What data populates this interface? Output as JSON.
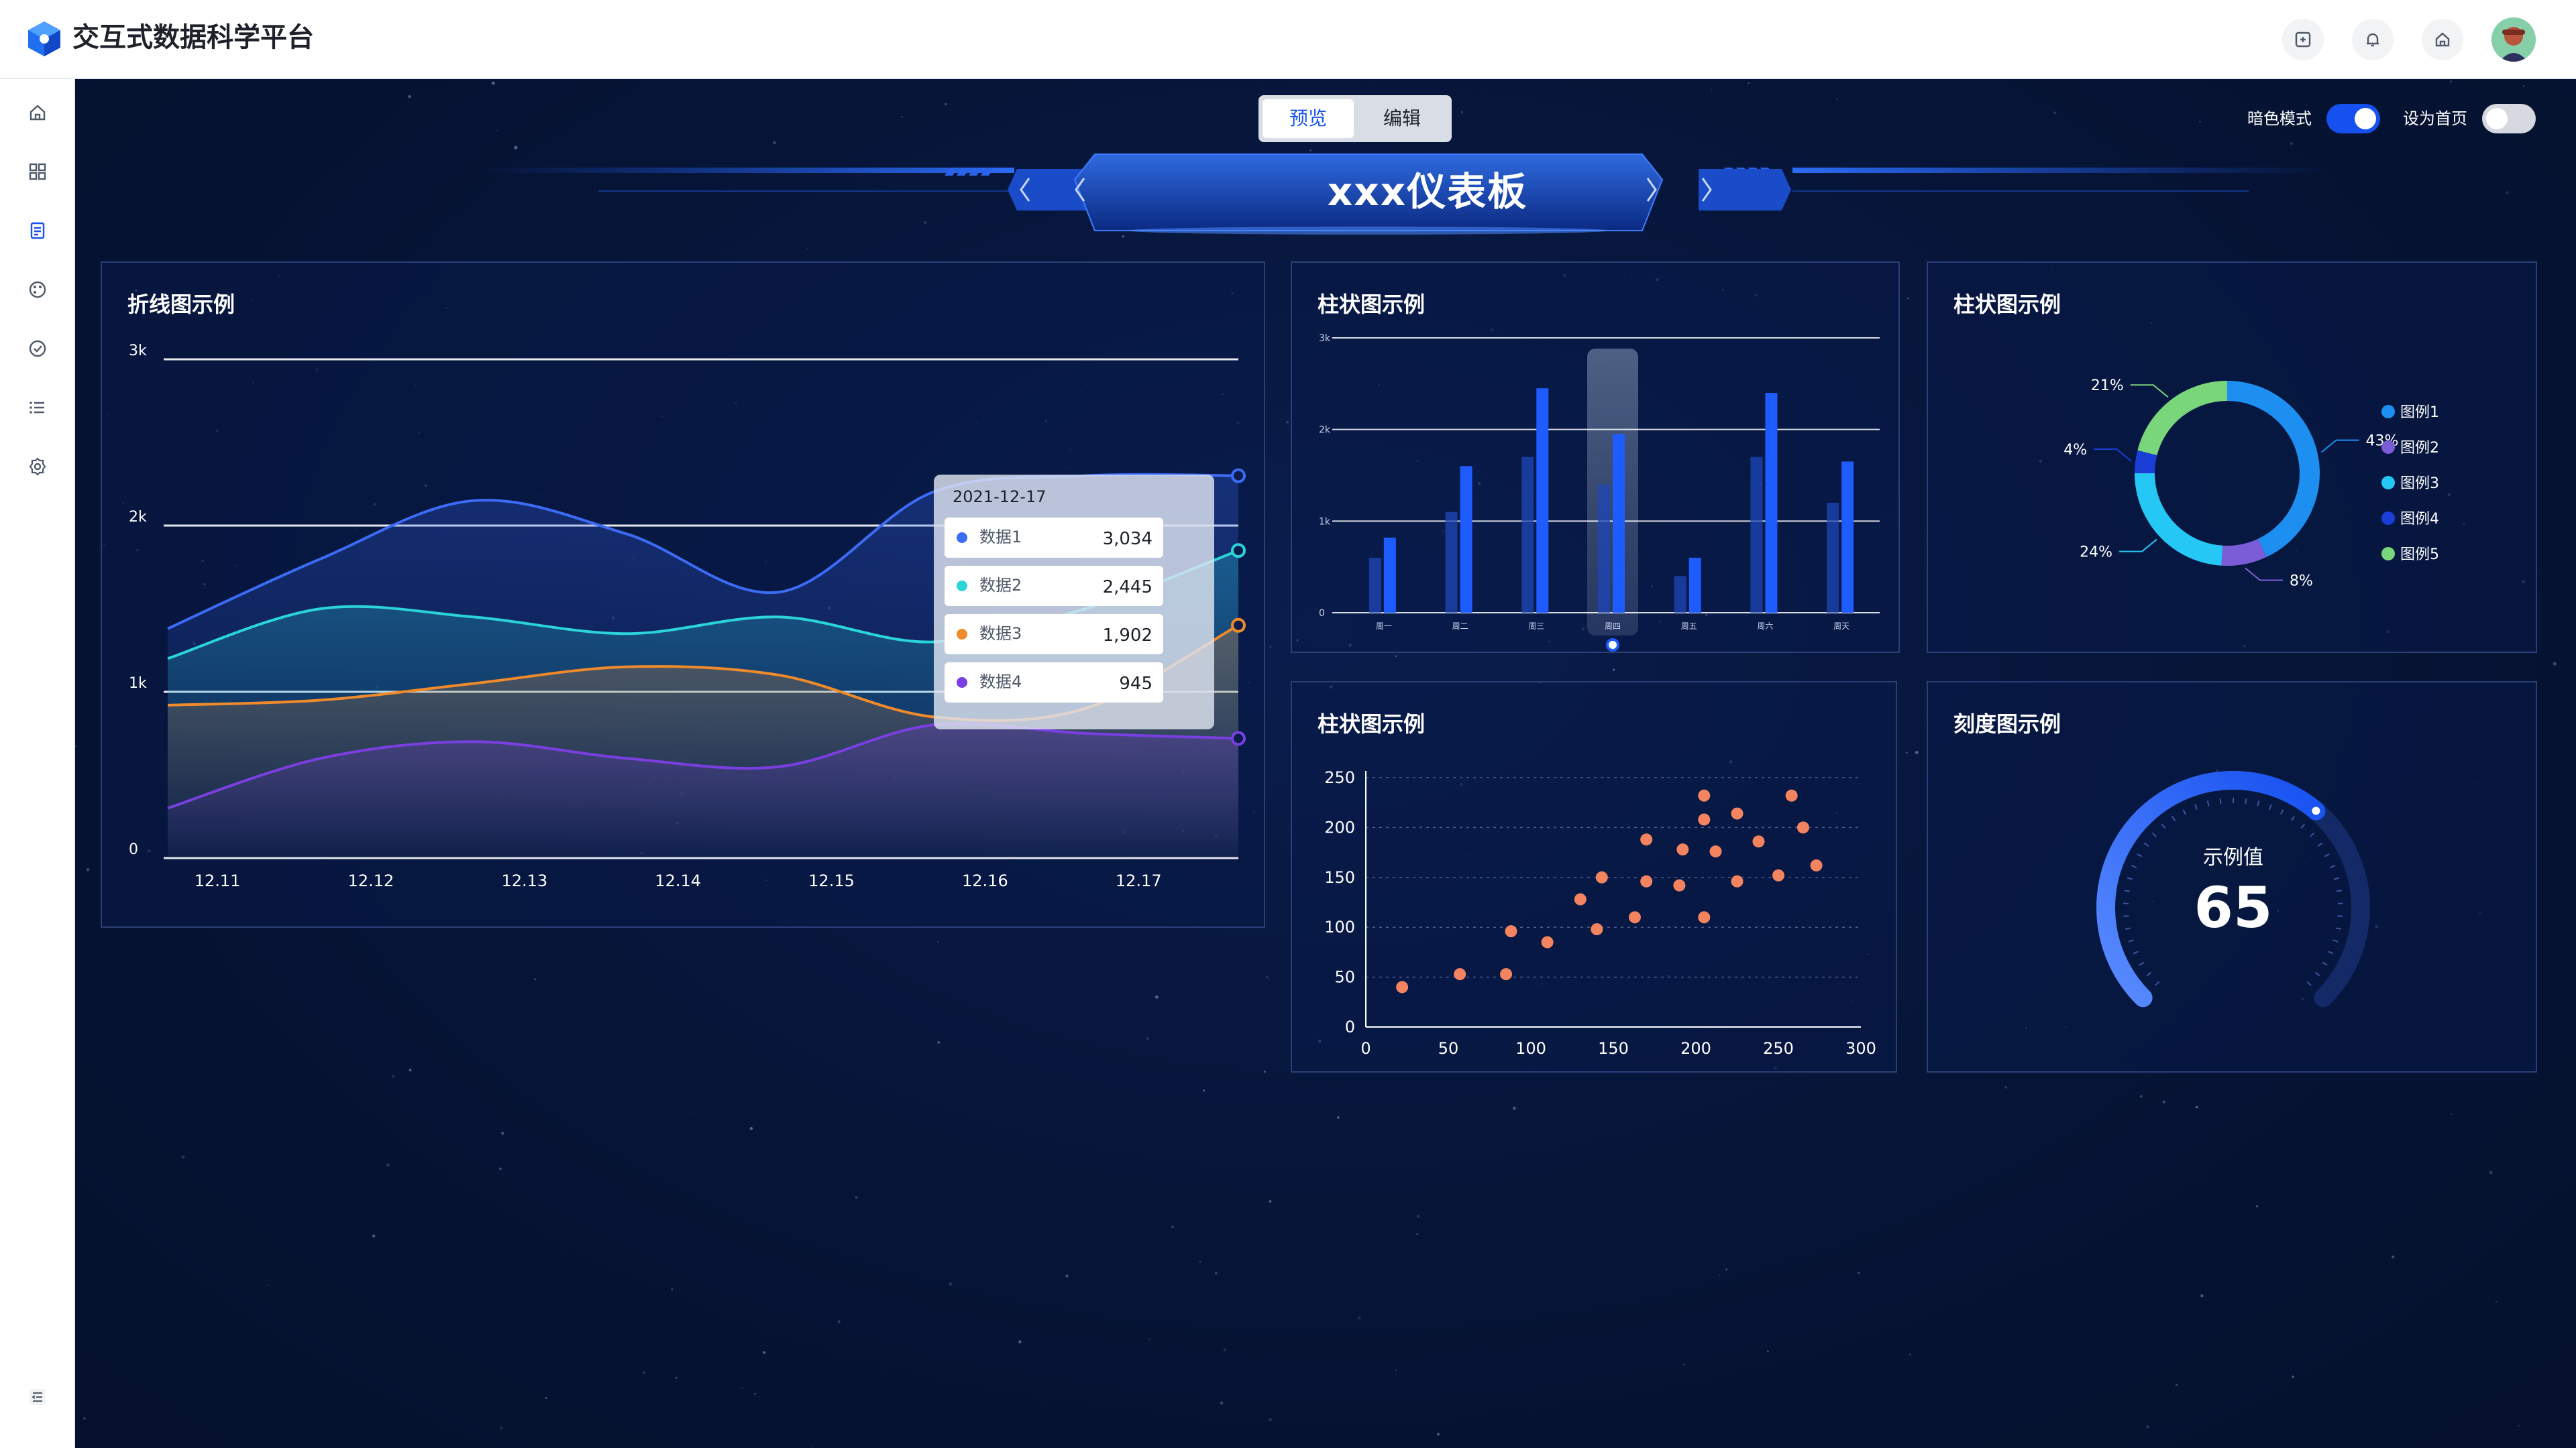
{
  "app": {
    "title": "交互式数据科学平台"
  },
  "header": {
    "icons": [
      "fullscreen-icon",
      "bell-icon",
      "home-icon"
    ],
    "avatar": "user-avatar"
  },
  "sidebar": {
    "items": [
      "home-icon",
      "grid-icon",
      "document-icon",
      "palette-icon",
      "check-circle-icon",
      "list-icon",
      "settings-icon"
    ],
    "collapse": "collapse-icon"
  },
  "mode_tabs": {
    "preview": "预览",
    "edit": "编辑",
    "active": "预览"
  },
  "toggles": {
    "dark_mode": {
      "label": "暗色模式",
      "on": true
    },
    "set_homepage": {
      "label": "设为首页",
      "on": false
    }
  },
  "dashboard": {
    "title": "xxx仪表板"
  },
  "colors": {
    "accent": "#1650f0",
    "bg": "#061233",
    "panel_border": "#2a3f76",
    "series1": "#3c6bf5",
    "series2": "#2ad4d8",
    "series3": "#f08a2a",
    "series4": "#7a3fe0",
    "scatter": "#f4845f"
  },
  "line_chart": {
    "title": "折线图示例",
    "tooltip": {
      "date": "2021-12-17",
      "rows": [
        {
          "name": "数据1",
          "value": "3,034"
        },
        {
          "name": "数据2",
          "value": "2,445"
        },
        {
          "name": "数据3",
          "value": "1,902"
        },
        {
          "name": "数据4",
          "value": "945"
        }
      ]
    }
  },
  "bar_chart": {
    "title": "柱状图示例"
  },
  "donut_chart": {
    "title": "柱状图示例"
  },
  "scatter_chart": {
    "title": "柱状图示例"
  },
  "gauge_chart": {
    "title": "刻度图示例",
    "label": "示例值",
    "value": 65
  },
  "chart_data": [
    {
      "type": "line",
      "title": "折线图示例",
      "x": [
        "12.11",
        "12.12",
        "12.13",
        "12.14",
        "12.15",
        "12.16",
        "12.17"
      ],
      "yticks": [
        "0",
        "1k",
        "2k",
        "3k"
      ],
      "ylim": [
        0,
        3000
      ],
      "grid": true,
      "series": [
        {
          "name": "数据1",
          "values": [
            1380,
            1800,
            2150,
            1950,
            1600,
            2200,
            2300,
            2300
          ]
        },
        {
          "name": "数据2",
          "values": [
            1200,
            1500,
            1450,
            1350,
            1450,
            1300,
            1500,
            1850
          ]
        },
        {
          "name": "数据3",
          "values": [
            920,
            950,
            1050,
            1150,
            1100,
            850,
            900,
            1400
          ]
        },
        {
          "name": "数据4",
          "values": [
            300,
            600,
            700,
            600,
            550,
            800,
            750,
            720
          ]
        }
      ]
    },
    {
      "type": "bar",
      "title": "柱状图示例",
      "categories": [
        "周一",
        "周二",
        "周三",
        "周四",
        "周五",
        "周六",
        "周天"
      ],
      "yticks": [
        "0",
        "1k",
        "2k",
        "3k"
      ],
      "ylim": [
        0,
        3000
      ],
      "highlight": "周四",
      "series": [
        {
          "values": [
            600,
            1100,
            1700,
            1400,
            400,
            1700,
            1200
          ]
        },
        {
          "values": [
            820,
            1600,
            2450,
            1950,
            600,
            2400,
            1650
          ]
        }
      ]
    },
    {
      "type": "pie",
      "title": "柱状图示例",
      "legend": [
        "图例1",
        "图例2",
        "图例3",
        "图例4",
        "图例5"
      ],
      "values": [
        43,
        8,
        24,
        4,
        21
      ],
      "labels": [
        "43%",
        "8%",
        "24%",
        "4%",
        "21%"
      ],
      "colors": [
        "#1d8ff0",
        "#7a5cd6",
        "#25c8f5",
        "#1a3ed6",
        "#7ad67a"
      ]
    },
    {
      "type": "scatter",
      "title": "柱状图示例",
      "xticks": [
        "0",
        "50",
        "100",
        "150",
        "200",
        "250",
        "300"
      ],
      "yticks": [
        "0",
        "50",
        "100",
        "150",
        "200",
        "250"
      ],
      "xlim": [
        0,
        300
      ],
      "ylim": [
        0,
        250
      ],
      "points": [
        [
          22,
          40
        ],
        [
          57,
          53
        ],
        [
          85,
          53
        ],
        [
          88,
          96
        ],
        [
          110,
          85
        ],
        [
          130,
          128
        ],
        [
          140,
          98
        ],
        [
          143,
          150
        ],
        [
          163,
          110
        ],
        [
          170,
          146
        ],
        [
          170,
          188
        ],
        [
          190,
          142
        ],
        [
          192,
          178
        ],
        [
          205,
          110
        ],
        [
          205,
          208
        ],
        [
          205,
          232
        ],
        [
          212,
          176
        ],
        [
          225,
          146
        ],
        [
          225,
          214
        ],
        [
          238,
          186
        ],
        [
          250,
          152
        ],
        [
          258,
          232
        ],
        [
          265,
          200
        ],
        [
          273,
          162
        ]
      ]
    },
    {
      "type": "gauge",
      "title": "刻度图示例",
      "label": "示例值",
      "value": 65,
      "range": [
        0,
        100
      ]
    }
  ]
}
